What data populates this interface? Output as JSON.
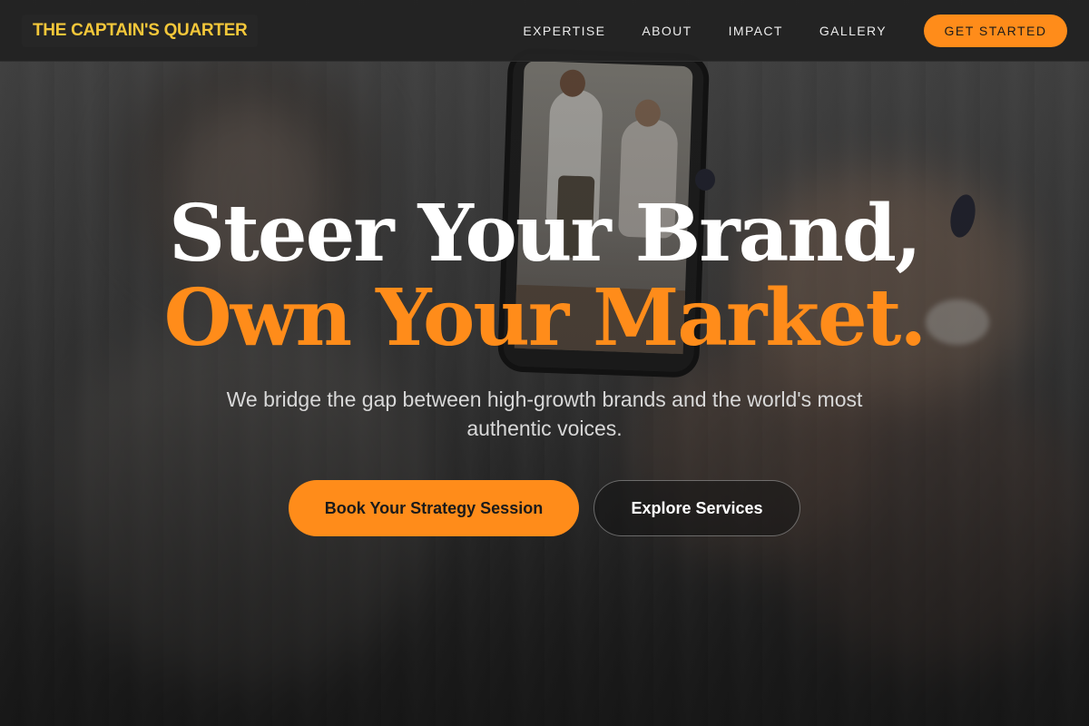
{
  "brand": {
    "name": "THE CAPTAIN'S QUARTER",
    "color": "#f3c73a"
  },
  "nav": {
    "links": [
      "EXPERTISE",
      "ABOUT",
      "IMPACT",
      "GALLERY"
    ],
    "cta_label": "GET STARTED"
  },
  "hero": {
    "headline_line1": "Steer Your Brand,",
    "headline_line2": "Own Your Market.",
    "subtitle": "We bridge the gap between high-growth brands and the world's most authentic voices.",
    "primary_button": "Book Your Strategy Session",
    "secondary_button": "Explore Services"
  },
  "colors": {
    "accent": "#ff8c1a",
    "navbar_bg": "#222222",
    "headline_white": "#ffffff"
  }
}
